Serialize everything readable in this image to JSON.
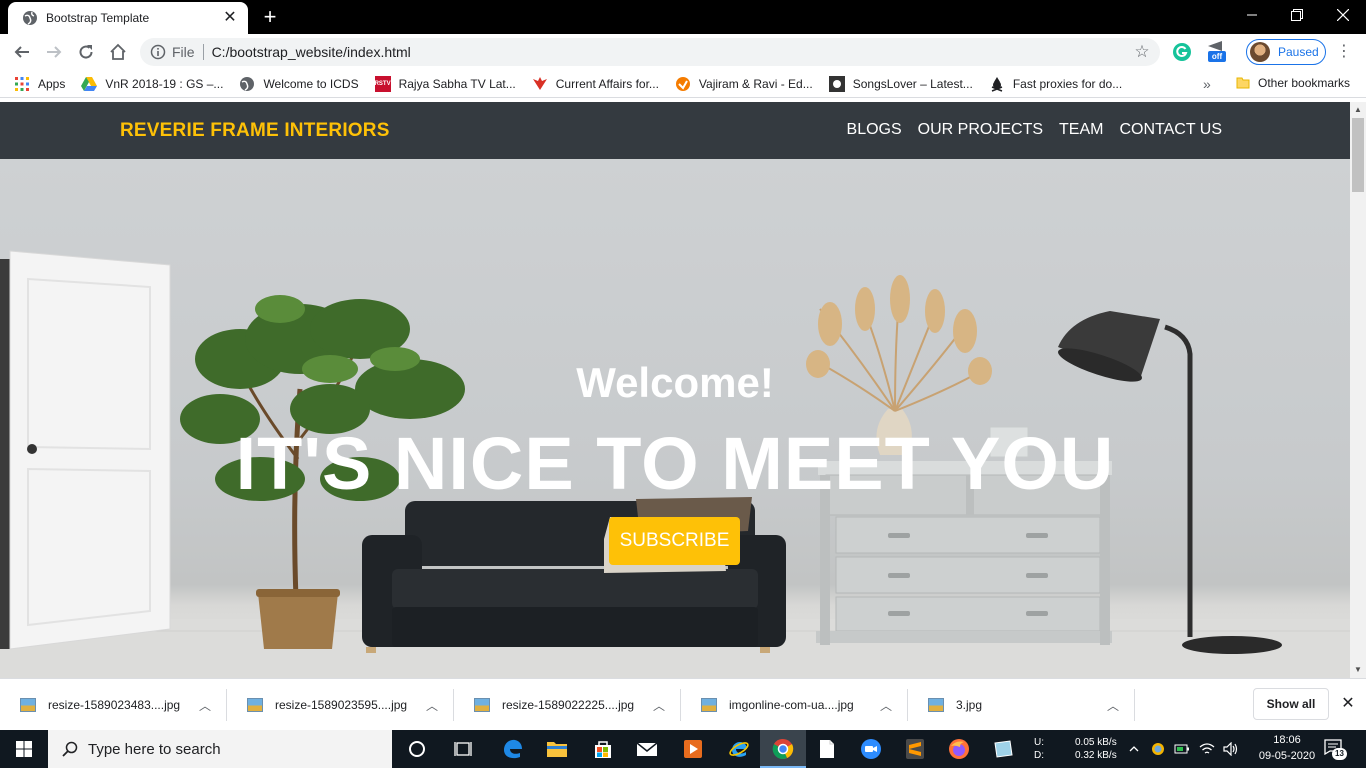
{
  "browser": {
    "tab_title": "Bootstrap Template",
    "omnibox_scheme": "File",
    "url": "C:/bootstrap_website/index.html",
    "profile_label": "Paused",
    "extension_badge": "off"
  },
  "bookmarks": {
    "items": [
      "Apps",
      "VnR 2018-19 : GS –...",
      "Welcome to ICDS",
      "Rajya Sabha TV Lat...",
      "Current Affairs for...",
      "Vajiram & Ravi - Ed...",
      "SongsLover – Latest...",
      "Fast proxies for do..."
    ],
    "rstv_icon_text": "RSTV",
    "more": "»",
    "other": "Other bookmarks"
  },
  "site": {
    "brand": "REVERIE FRAME INTERIORS",
    "nav": [
      "BLOGS",
      "OUR PROJECTS",
      "TEAM",
      "CONTACT US"
    ],
    "welcome": "Welcome!",
    "headline": "IT'S NICE TO MEET YOU",
    "cta": "SUBSCRIBE"
  },
  "downloads": {
    "files": [
      "resize-1589023483....jpg",
      "resize-1589023595....jpg",
      "resize-1589022225....jpg",
      "imgonline-com-ua....jpg",
      "3.jpg"
    ],
    "show_all": "Show all"
  },
  "taskbar": {
    "search_placeholder": "Type here to search",
    "net_u_label": "U:",
    "net_d_label": "D:",
    "upload": "0.05 kB/s",
    "download": "0.32 kB/s",
    "time": "18:06",
    "date": "09-05-2020",
    "notification_count": "13"
  },
  "colors": {
    "brand": "#fec107",
    "navbar": "#343a40",
    "chrome_accent": "#1a73e8"
  },
  "icons": [
    "globe-icon",
    "back-icon",
    "forward-icon",
    "reload-icon",
    "home-icon",
    "info-icon",
    "star-icon",
    "grammarly-icon",
    "windows-start-icon",
    "search-icon",
    "cortana-icon",
    "task-view-icon",
    "edge-icon",
    "file-explorer-icon",
    "store-icon",
    "mail-icon",
    "media-player-icon",
    "ie-icon",
    "chrome-icon",
    "notepad-icon",
    "zoom-icon",
    "sublime-icon",
    "firefox-icon",
    "snip-icon",
    "chevron-up-icon",
    "wifi-icon",
    "volume-icon",
    "notification-icon"
  ]
}
